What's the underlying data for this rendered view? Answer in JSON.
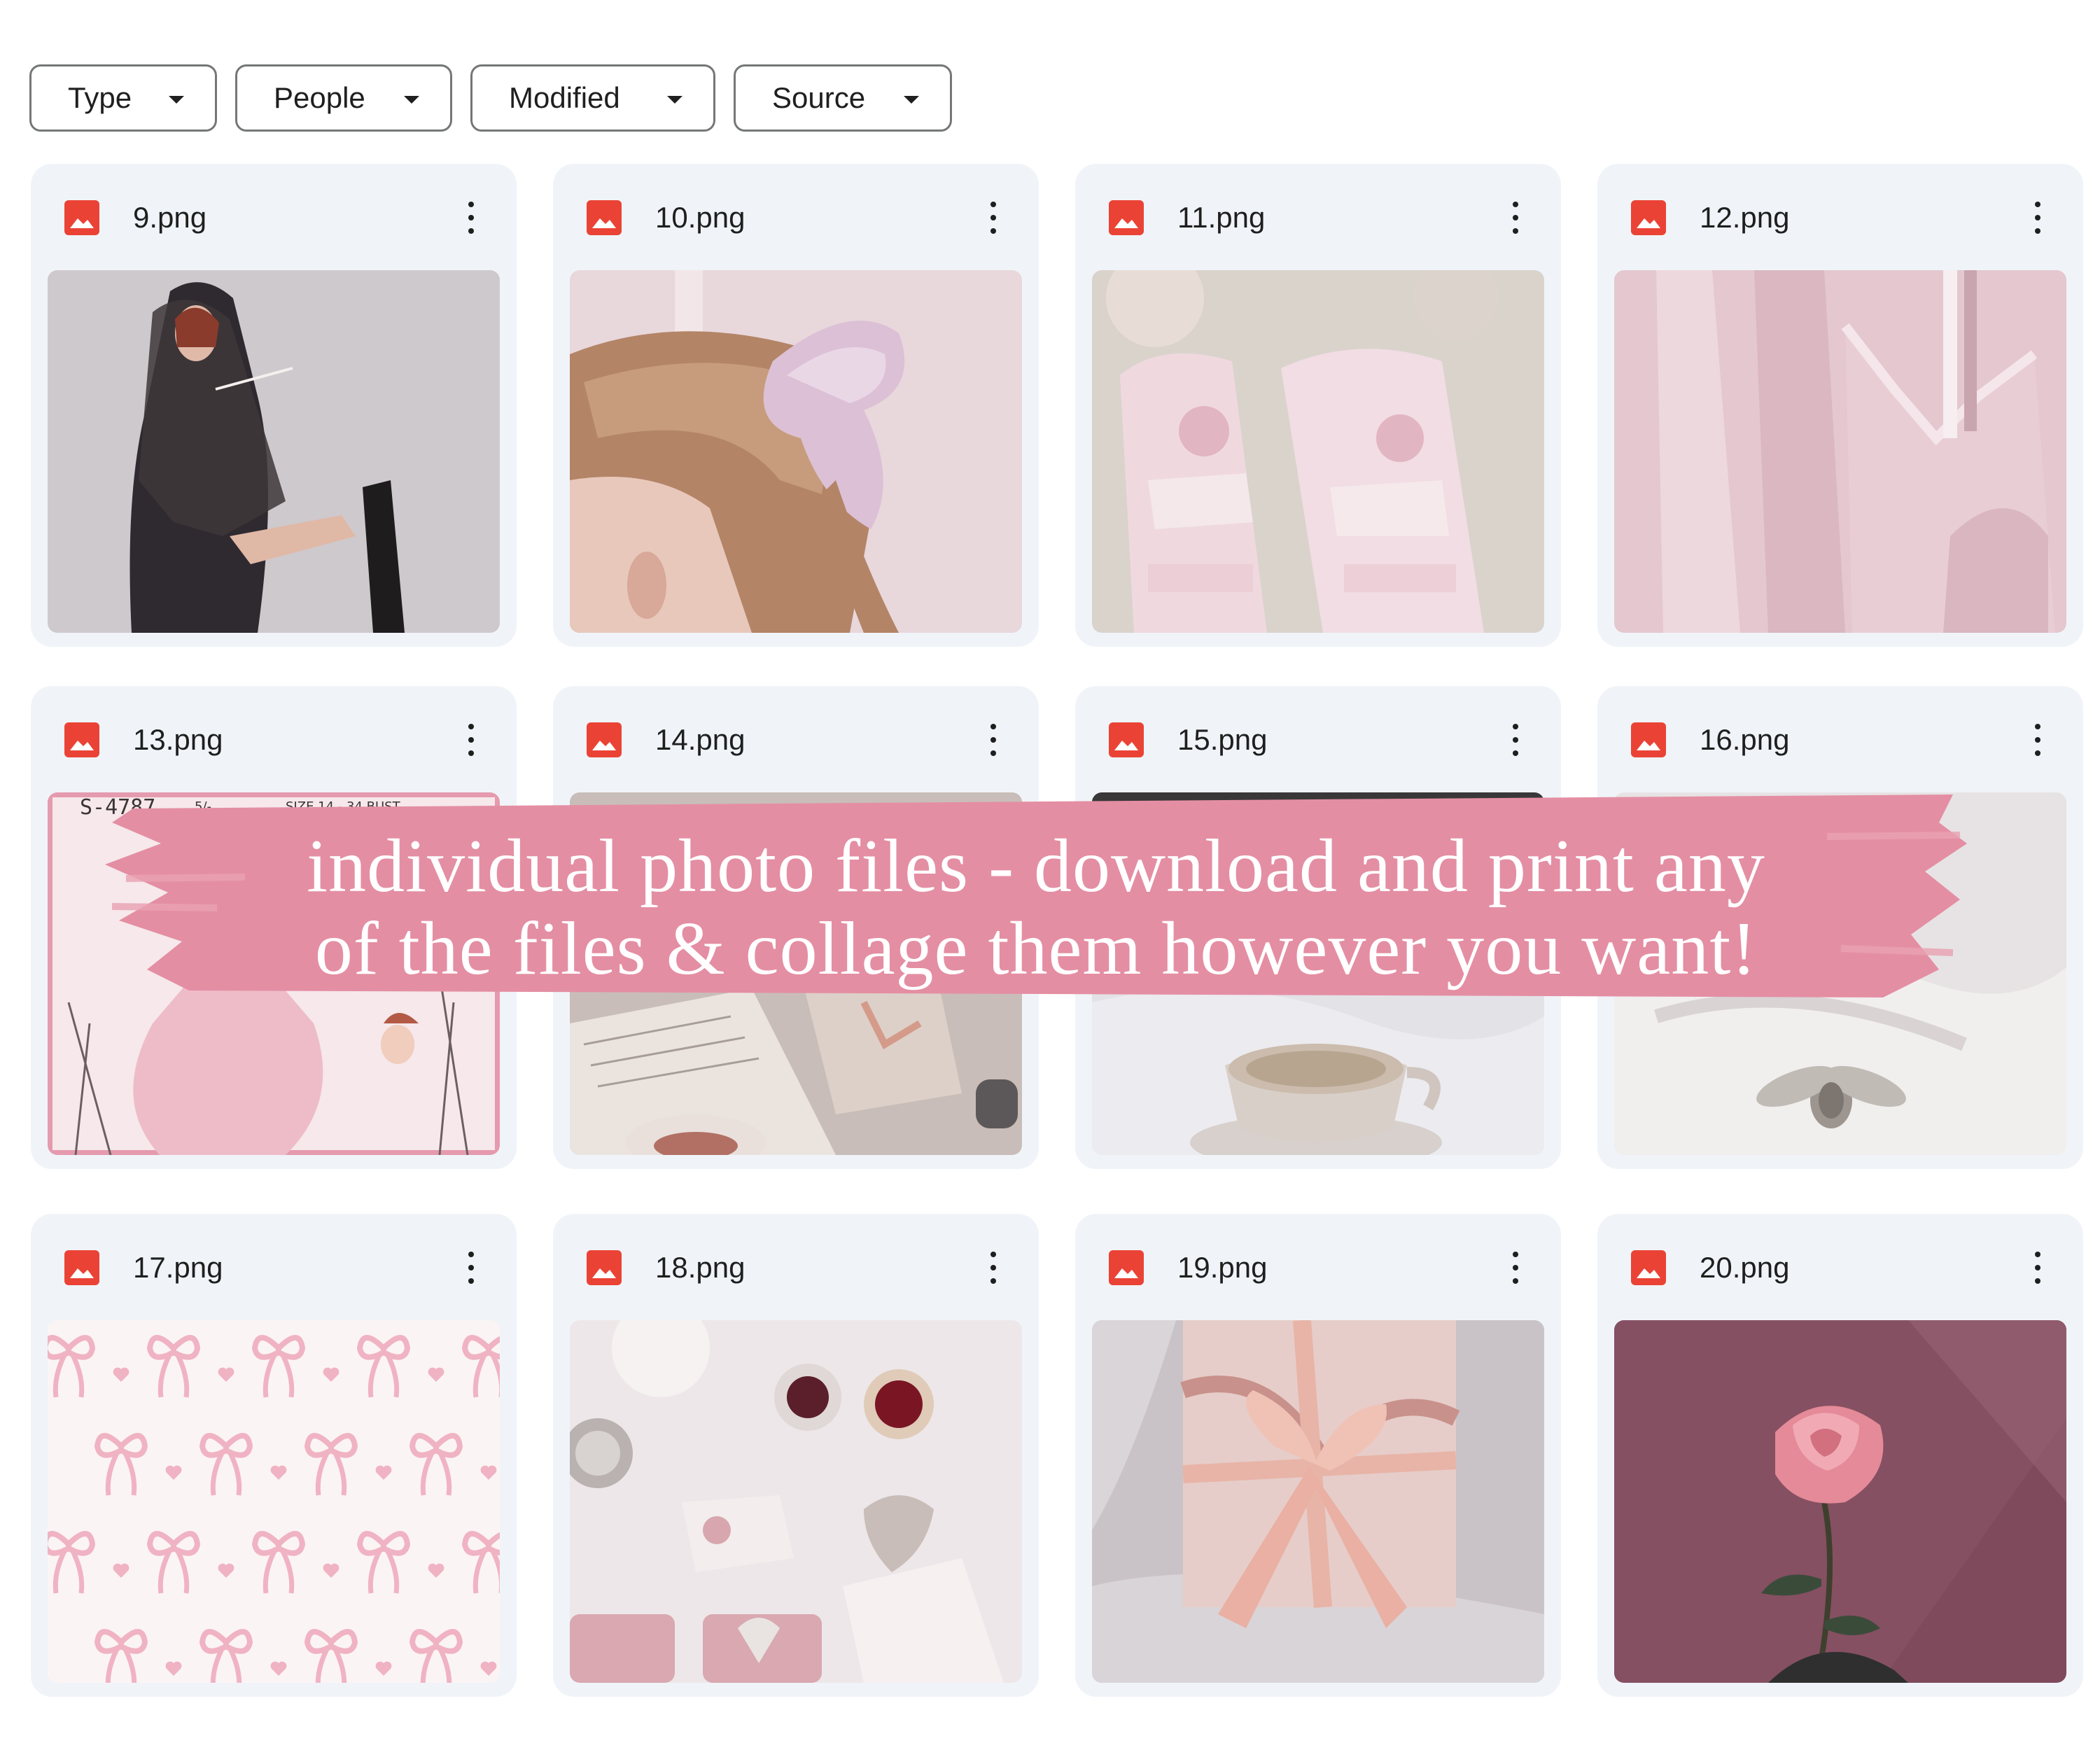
{
  "filters": [
    {
      "label": "Type"
    },
    {
      "label": "People"
    },
    {
      "label": "Modified"
    },
    {
      "label": "Source"
    }
  ],
  "files": [
    {
      "name": "9.png",
      "icon": "image-file-icon",
      "thumbnail": "woman-black-lace-veil"
    },
    {
      "name": "10.png",
      "icon": "image-file-icon",
      "thumbnail": "hair-pink-bow"
    },
    {
      "name": "11.png",
      "icon": "image-file-icon",
      "thumbnail": "pink-lace-gloves"
    },
    {
      "name": "12.png",
      "icon": "image-file-icon",
      "thumbnail": "pink-lace-slip"
    },
    {
      "name": "13.png",
      "icon": "image-file-icon",
      "thumbnail": "vintage-dress-pattern"
    },
    {
      "name": "14.png",
      "icon": "image-file-icon",
      "thumbnail": "book-and-teacup"
    },
    {
      "name": "15.png",
      "icon": "image-file-icon",
      "thumbnail": "teacup-on-linen"
    },
    {
      "name": "16.png",
      "icon": "image-file-icon",
      "thumbnail": "bee-brooch-on-fabric"
    },
    {
      "name": "17.png",
      "icon": "image-file-icon",
      "thumbnail": "pink-bow-pattern"
    },
    {
      "name": "18.png",
      "icon": "image-file-icon",
      "thumbnail": "jewelry-flatlay"
    },
    {
      "name": "19.png",
      "icon": "image-file-icon",
      "thumbnail": "wrapped-gift-ribbon"
    },
    {
      "name": "20.png",
      "icon": "image-file-icon",
      "thumbnail": "pink-rose"
    }
  ],
  "pattern_text": {
    "code": "S-4787",
    "price": "5/-",
    "size": "SIZE 14 - 34 BUST"
  },
  "banner": {
    "line1": "individual photo files - download and print any",
    "line2": "of the files & collage them however you want!"
  },
  "colors": {
    "chip_border": "#747775",
    "card_bg": "#f0f4f9",
    "image_icon": "#ea4335",
    "banner_pink": "#e48ea3",
    "text": "#1f1f1f"
  }
}
